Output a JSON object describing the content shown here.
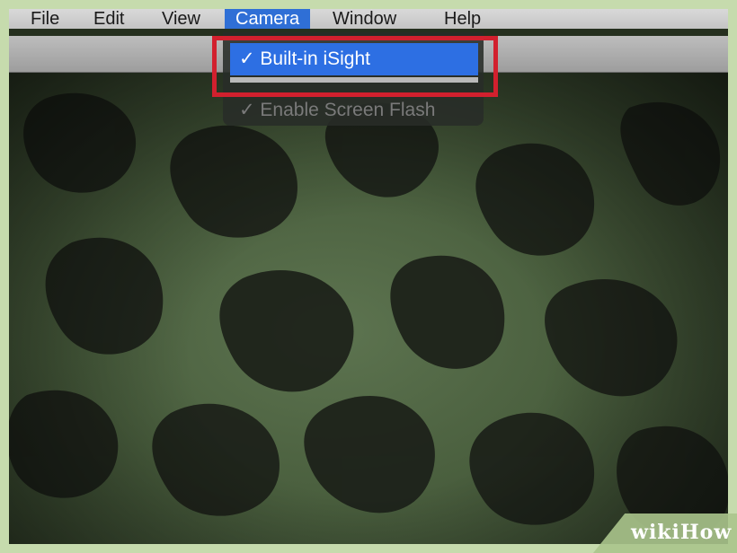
{
  "menubar": {
    "items": [
      "File",
      "Edit",
      "View",
      "Camera",
      "Window",
      "Help"
    ],
    "active": "Camera"
  },
  "camera_menu": {
    "items": [
      {
        "label": "✓ Built-in iSight",
        "state": "highlighted"
      },
      {
        "label": "✓ Enable Screen Flash",
        "state": "normal"
      }
    ]
  },
  "colors": {
    "menu_highlight": "#2d6fe3",
    "annotation_outline": "#d2202e",
    "frame": "#c6dbad"
  },
  "watermark": "wikiHow"
}
